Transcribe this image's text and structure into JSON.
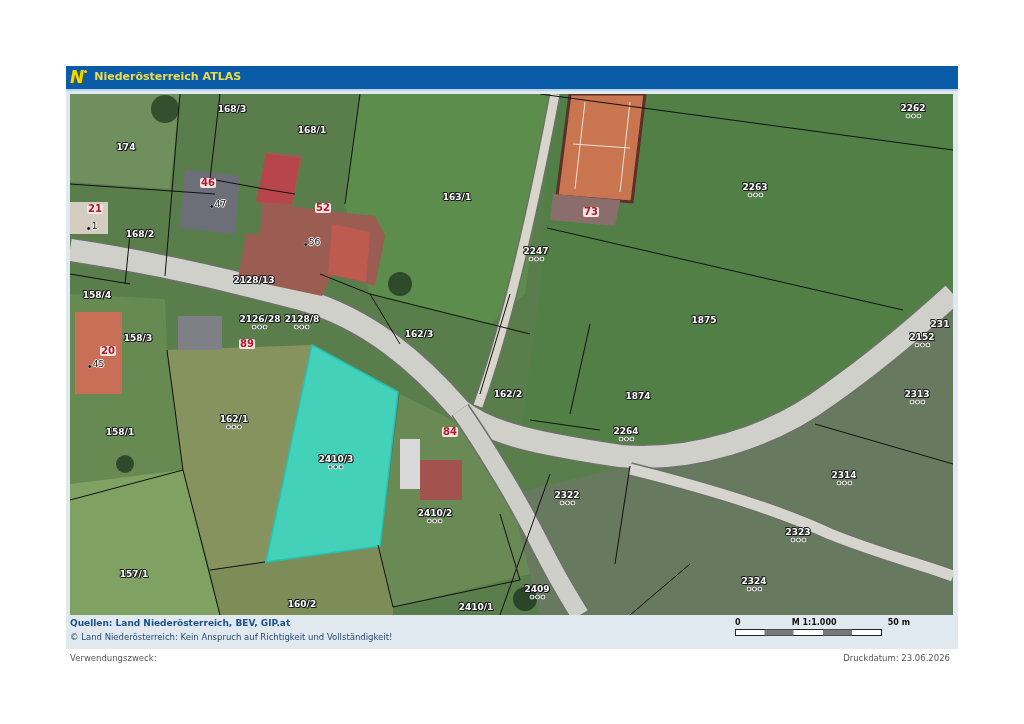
{
  "header": {
    "logo": "N",
    "title": "Niederösterreich ATLAS"
  },
  "map": {
    "labels": [
      {
        "text": "168/3",
        "kind": "parcel",
        "symbols": false
      },
      {
        "text": "174",
        "kind": "parcel",
        "symbols": false
      },
      {
        "text": "168/1",
        "kind": "parcel",
        "symbols": false
      },
      {
        "text": "46",
        "kind": "house",
        "symbols": false
      },
      {
        "text": "47",
        "kind": "address",
        "symbols": false
      },
      {
        "text": "21",
        "kind": "house",
        "symbols": false
      },
      {
        "text": "1",
        "kind": "address",
        "symbols": false
      },
      {
        "text": "168/2",
        "kind": "parcel",
        "symbols": false
      },
      {
        "text": "52",
        "kind": "house",
        "symbols": false
      },
      {
        "text": "56",
        "kind": "address",
        "symbols": false
      },
      {
        "text": "163/1",
        "kind": "parcel",
        "symbols": false
      },
      {
        "text": "2247",
        "kind": "parcel",
        "symbols": true
      },
      {
        "text": "2128/13",
        "kind": "parcel",
        "symbols": false
      },
      {
        "text": "158/4",
        "kind": "parcel",
        "symbols": false
      },
      {
        "text": "2126/28",
        "kind": "parcel",
        "symbols": true
      },
      {
        "text": "2128/8",
        "kind": "parcel",
        "symbols": true
      },
      {
        "text": "158/3",
        "kind": "parcel",
        "symbols": false
      },
      {
        "text": "162/3",
        "kind": "parcel",
        "symbols": false
      },
      {
        "text": "89",
        "kind": "house",
        "symbols": false
      },
      {
        "text": "20",
        "kind": "house",
        "symbols": false
      },
      {
        "text": "45",
        "kind": "address",
        "symbols": false
      },
      {
        "text": "162/1",
        "kind": "parcel",
        "symbols": true
      },
      {
        "text": "158/1",
        "kind": "parcel",
        "symbols": false
      },
      {
        "text": "2410/3",
        "kind": "parcel",
        "symbols": true
      },
      {
        "text": "84",
        "kind": "house",
        "symbols": false
      },
      {
        "text": "162/2",
        "kind": "parcel",
        "symbols": false
      },
      {
        "text": "2410/2",
        "kind": "parcel",
        "symbols": true
      },
      {
        "text": "157/1",
        "kind": "parcel",
        "symbols": false
      },
      {
        "text": "160/2",
        "kind": "parcel",
        "symbols": false
      },
      {
        "text": "2410/1",
        "kind": "parcel",
        "symbols": false
      },
      {
        "text": "2409",
        "kind": "parcel",
        "symbols": true
      },
      {
        "text": "2262",
        "kind": "parcel",
        "symbols": true
      },
      {
        "text": "73",
        "kind": "house",
        "symbols": false
      },
      {
        "text": "2263",
        "kind": "parcel",
        "symbols": true
      },
      {
        "text": "1875",
        "kind": "parcel",
        "symbols": false
      },
      {
        "text": "231",
        "kind": "parcel",
        "symbols": false
      },
      {
        "text": "2152",
        "kind": "parcel",
        "symbols": true
      },
      {
        "text": "1874",
        "kind": "parcel",
        "symbols": false
      },
      {
        "text": "2313",
        "kind": "parcel",
        "symbols": true
      },
      {
        "text": "2264",
        "kind": "parcel",
        "symbols": true
      },
      {
        "text": "2314",
        "kind": "parcel",
        "symbols": true
      },
      {
        "text": "2322",
        "kind": "parcel",
        "symbols": true
      },
      {
        "text": "2323",
        "kind": "parcel",
        "symbols": true
      },
      {
        "text": "2324",
        "kind": "parcel",
        "symbols": true
      }
    ]
  },
  "footer": {
    "sources": "Quellen: Land Niederösterreich, BEV, GIP.at",
    "disclaimer": "© Land Niederösterreich: Kein Anspruch auf Richtigkeit und Vollständigkeit!",
    "scale": {
      "start": "0",
      "ratio": "M 1:1.000",
      "end": "50 m"
    }
  },
  "purpose_label": "Verwendungszweck:",
  "print_date": "Druckdatum: 23.06.2026"
}
